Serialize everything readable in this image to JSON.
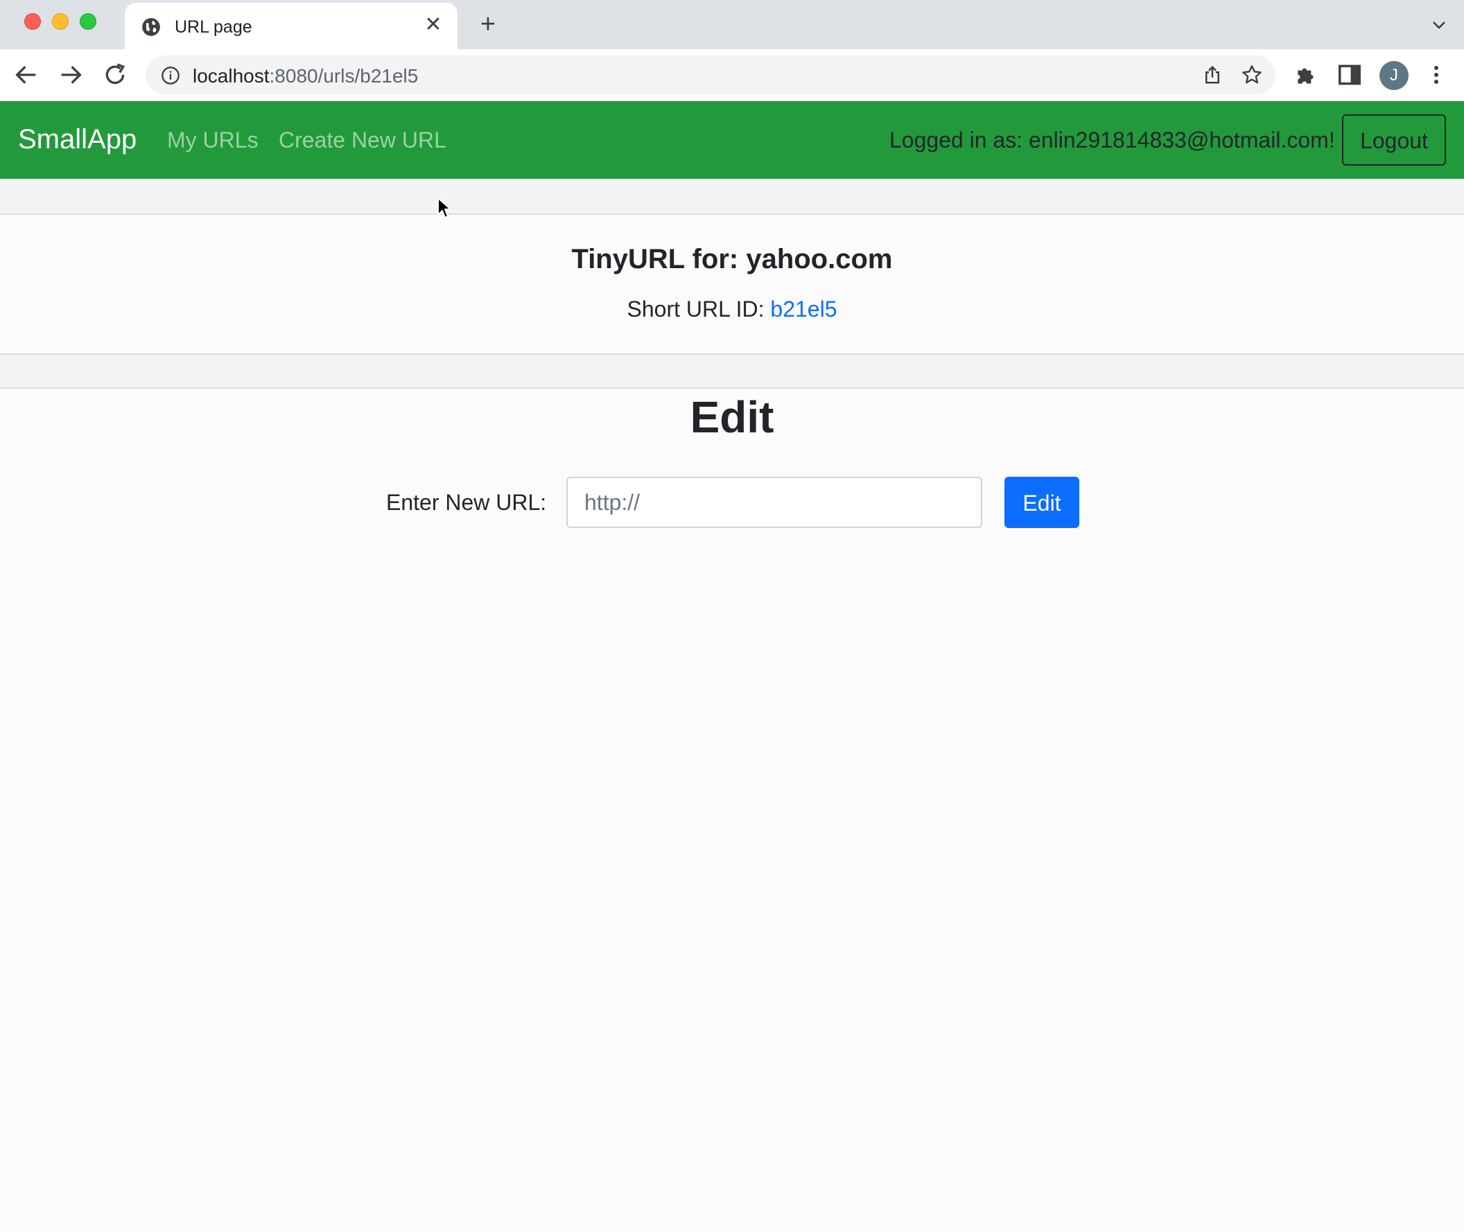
{
  "browser": {
    "tab_title": "URL page",
    "url_host": "localhost",
    "url_rest": ":8080/urls/b21el5",
    "profile_initial": "J"
  },
  "navbar": {
    "brand": "SmallApp",
    "links": [
      "My URLs",
      "Create New URL"
    ],
    "logged_in_text": "Logged in as: enlin291814833@hotmail.com!",
    "logout_label": "Logout"
  },
  "card": {
    "title": "TinyURL for: yahoo.com",
    "short_url_label": "Short URL ID:",
    "short_url_id": "b21el5"
  },
  "edit": {
    "heading": "Edit",
    "label": "Enter New URL:",
    "placeholder": "http://",
    "button_label": "Edit"
  },
  "colors": {
    "navbar": "#229a3b",
    "primary": "#0d6efd"
  },
  "icons": [
    "globe-icon",
    "close-icon",
    "plus-icon",
    "chevron-down-icon",
    "back-arrow-icon",
    "forward-arrow-icon",
    "reload-icon",
    "info-icon",
    "share-icon",
    "star-icon",
    "puzzle-icon",
    "sidepanel-icon",
    "kebab-menu-icon",
    "cursor-icon"
  ]
}
